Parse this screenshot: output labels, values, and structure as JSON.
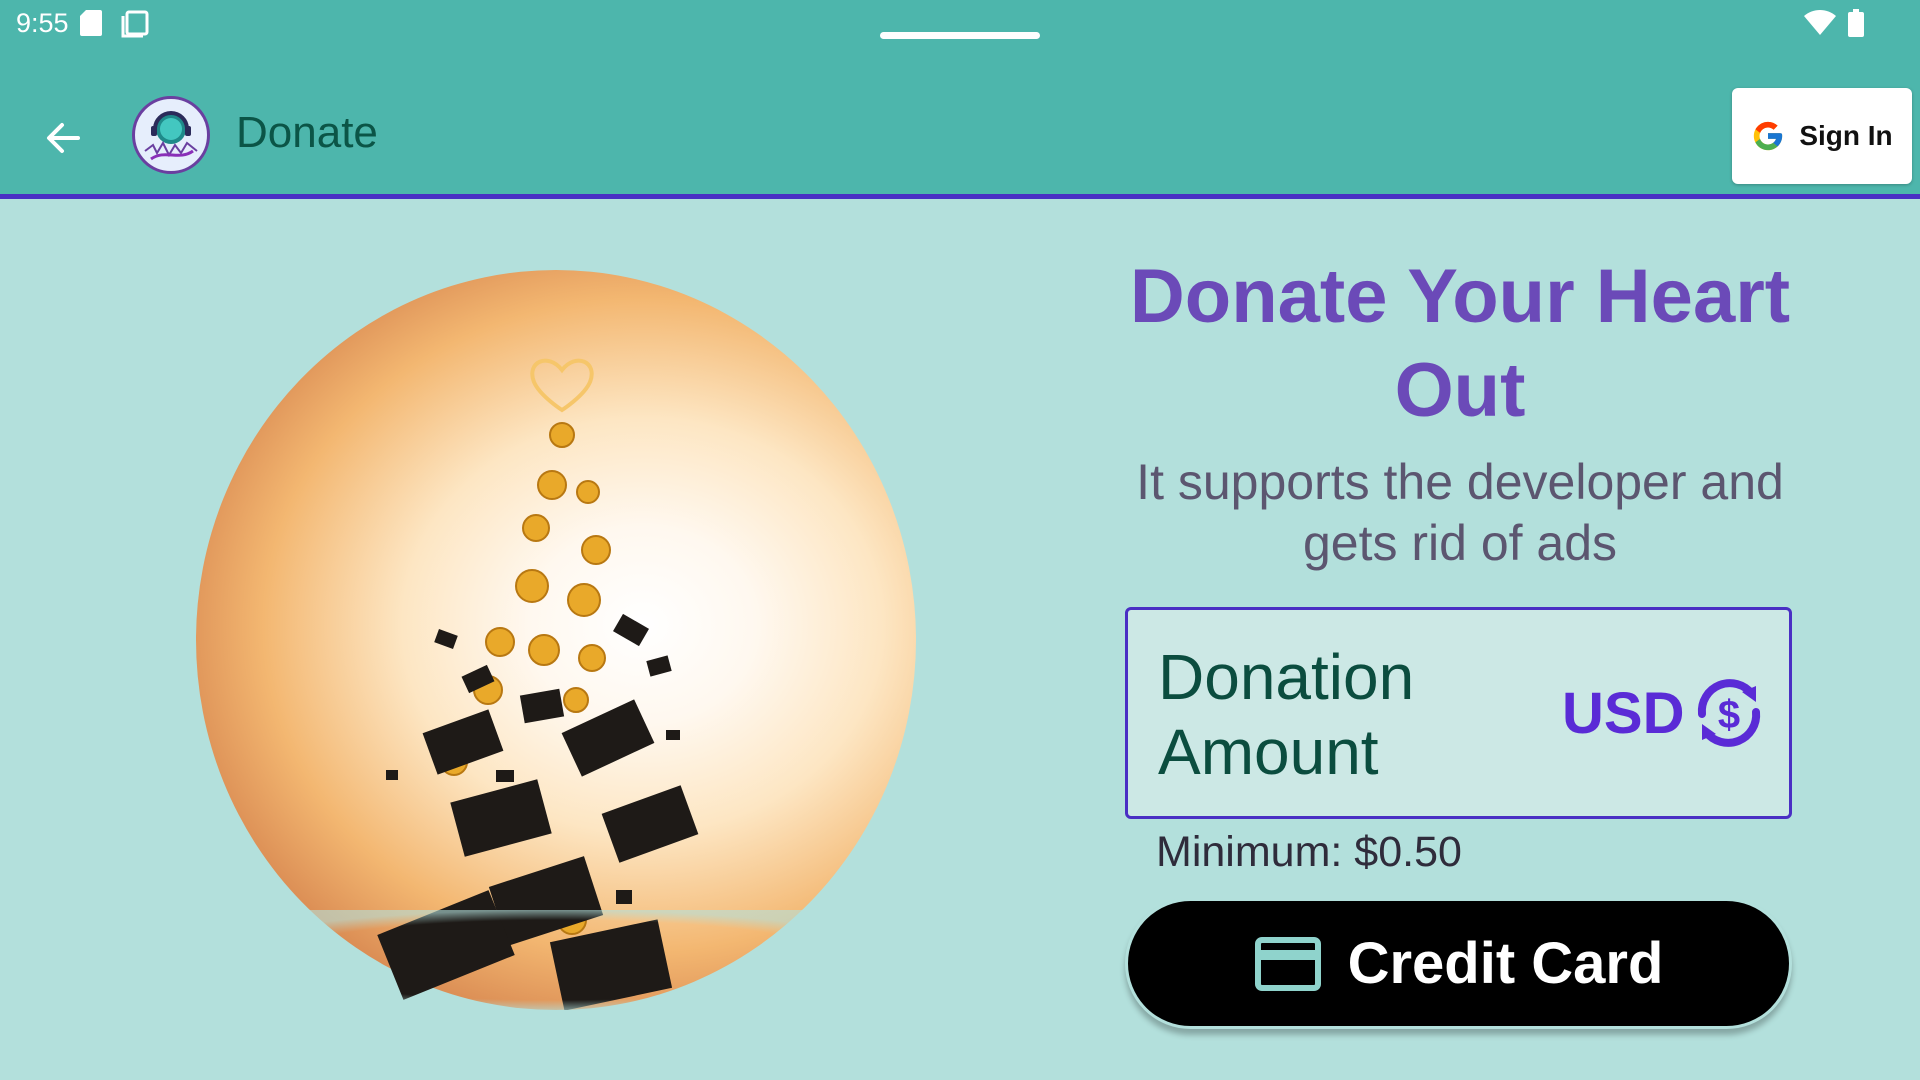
{
  "status_bar": {
    "time": "9:55",
    "icons": [
      "sd-card-icon",
      "screenshot-icon",
      "wifi-icon",
      "battery-icon"
    ]
  },
  "app_bar": {
    "title": "Donate",
    "back_icon": "arrow-left-icon",
    "logo_icon": "app-logo-icon",
    "sign_in_label": "Sign In",
    "sign_in_icon": "google-g-icon"
  },
  "content": {
    "headline": "Donate Your Heart Out",
    "subtitle": "It supports the developer and gets rid of ads",
    "amount_field": {
      "label": "Donation Amount",
      "currency": "USD",
      "currency_icon": "currency-swap-icon"
    },
    "minimum_text": "Minimum: $0.50",
    "credit_card_button": {
      "label": "Credit Card",
      "icon": "credit-card-icon"
    }
  },
  "colors": {
    "app_bar": "#4db6ac",
    "background": "#b3e0dc",
    "accent": "#4a2fc4",
    "headline": "#6b4ab8",
    "currency": "#5a2bd6"
  }
}
